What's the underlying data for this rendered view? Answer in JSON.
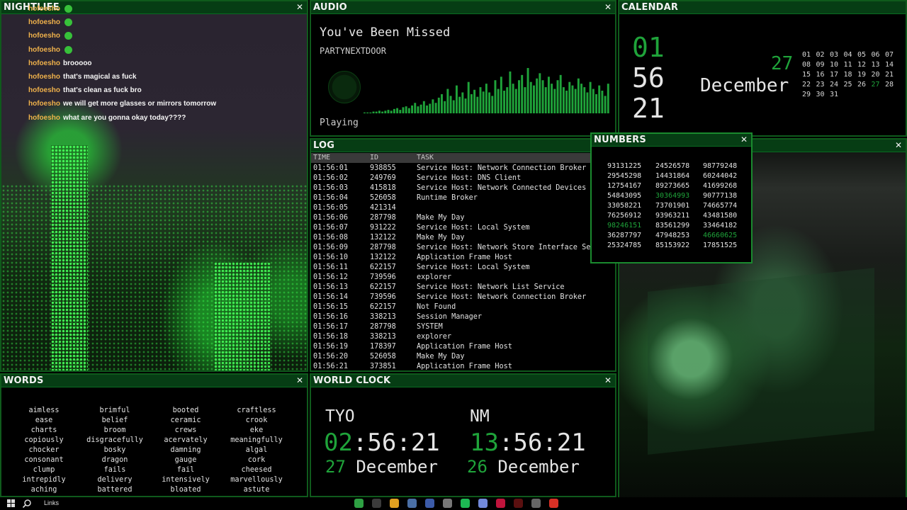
{
  "nightlife": {
    "title": "NIGHTLIFE",
    "chat": [
      {
        "user": "hofoesho",
        "msg": "",
        "emote": true
      },
      {
        "user": "hofoesho",
        "msg": "",
        "emote": true
      },
      {
        "user": "hofoesho",
        "msg": "",
        "emote": true
      },
      {
        "user": "hofoesho",
        "msg": "",
        "emote": true
      },
      {
        "user": "hofoesho",
        "msg": "brooooo",
        "emote": false
      },
      {
        "user": "hofoesho",
        "msg": "that's magical as fuck",
        "emote": false
      },
      {
        "user": "hofoesho",
        "msg": "that's clean as fuck bro",
        "emote": false
      },
      {
        "user": "hofoesho",
        "msg": "we will get more glasses or mirrors tomorrow",
        "emote": false
      },
      {
        "user": "hofoesho",
        "msg": "what are you gonna okay today????",
        "emote": false
      }
    ]
  },
  "audio": {
    "title": "AUDIO",
    "song": "You've Been Missed",
    "artist": "PARTYNEXTDOOR",
    "status": "Playing",
    "bars": [
      1,
      1,
      1,
      2,
      2,
      3,
      2,
      3,
      4,
      3,
      5,
      6,
      4,
      7,
      8,
      6,
      9,
      12,
      8,
      10,
      14,
      9,
      11,
      16,
      12,
      18,
      22,
      14,
      28,
      20,
      15,
      32,
      19,
      24,
      17,
      36,
      22,
      27,
      19,
      30,
      25,
      34,
      24,
      20,
      38,
      28,
      42,
      26,
      30,
      48,
      34,
      28,
      38,
      44,
      30,
      52,
      36,
      32,
      40,
      46,
      38,
      30,
      42,
      34,
      28,
      38,
      44,
      30,
      26,
      36,
      32,
      28,
      40,
      34,
      30,
      24,
      36,
      28,
      22,
      32,
      26,
      20,
      34
    ]
  },
  "calendar": {
    "title": "CALENDAR",
    "hour": "01",
    "minute": "56",
    "second": "21",
    "day": "27",
    "month": "December",
    "days": [
      "01",
      "02",
      "03",
      "04",
      "05",
      "06",
      "07",
      "08",
      "09",
      "10",
      "11",
      "12",
      "13",
      "14",
      "15",
      "16",
      "17",
      "18",
      "19",
      "20",
      "21",
      "22",
      "23",
      "24",
      "25",
      "26",
      "27",
      "28",
      "29",
      "30",
      "31"
    ],
    "today": "27"
  },
  "log": {
    "title": "LOG",
    "headers": {
      "time": "TIME",
      "id": "ID",
      "task": "TASK"
    },
    "rows": [
      [
        "01:56:01",
        "938855",
        "Service Host: Network Connection Broker"
      ],
      [
        "01:56:02",
        "249769",
        "Service Host: DNS Client"
      ],
      [
        "01:56:03",
        "415818",
        "Service Host: Network Connected Devices"
      ],
      [
        "01:56:04",
        "526058",
        "Runtime Broker"
      ],
      [
        "01:56:05",
        "421314",
        ""
      ],
      [
        "01:56:06",
        "287798",
        "Make My Day"
      ],
      [
        "01:56:07",
        "931222",
        "Service Host: Local System"
      ],
      [
        "01:56:08",
        "132122",
        "Make My Day"
      ],
      [
        "01:56:09",
        "287798",
        "Service Host: Network Store Interface Ser"
      ],
      [
        "01:56:10",
        "132122",
        "Application Frame Host"
      ],
      [
        "01:56:11",
        "622157",
        "Service Host: Local System"
      ],
      [
        "01:56:12",
        "739596",
        "explorer"
      ],
      [
        "01:56:13",
        "622157",
        "Service Host: Network List Service"
      ],
      [
        "01:56:14",
        "739596",
        "Service Host: Network Connection Broker"
      ],
      [
        "01:56:15",
        "622157",
        "Not Found"
      ],
      [
        "01:56:16",
        "338213",
        "Session Manager"
      ],
      [
        "01:56:17",
        "287798",
        "SYSTEM"
      ],
      [
        "01:56:18",
        "338213",
        "explorer"
      ],
      [
        "01:56:19",
        "178397",
        "Application Frame Host"
      ],
      [
        "01:56:20",
        "526058",
        "Make My Day"
      ],
      [
        "01:56:21",
        "373851",
        "Application Frame Host"
      ]
    ]
  },
  "numbers": {
    "title": "NUMBERS",
    "values": [
      [
        "93131225",
        "24526578",
        "98779248"
      ],
      [
        "29545298",
        "14431864",
        "60244042"
      ],
      [
        "12754167",
        "89273665",
        "41699268"
      ],
      [
        "54843095",
        "30364993",
        "90777138"
      ],
      [
        "33058221",
        "73701901",
        "74665774"
      ],
      [
        "76256912",
        "93963211",
        "43481580"
      ],
      [
        "98246151",
        "83561299",
        "33464182"
      ],
      [
        "36287797",
        "47948253",
        "46660625"
      ],
      [
        "25324785",
        "85153922",
        "17851525"
      ]
    ],
    "highlighted": [
      "30364993",
      "98246151",
      "46660625"
    ]
  },
  "words": {
    "title": "WORDS",
    "columns": [
      [
        "aimless",
        "ease",
        "charts",
        "copiously",
        "chocker",
        "consonant",
        "clump",
        "intrepidly",
        "aching"
      ],
      [
        "brimful",
        "belief",
        "broom",
        "disgracefully",
        "bosky",
        "dragon",
        "fails",
        "delivery",
        "battered"
      ],
      [
        "booted",
        "ceramic",
        "crews",
        "acervately",
        "damning",
        "gauge",
        "fail",
        "intensively",
        "bloated"
      ],
      [
        "craftless",
        "crook",
        "eke",
        "meaningfully",
        "algal",
        "cork",
        "cheesed",
        "marvellously",
        "astute"
      ]
    ]
  },
  "worldclock": {
    "title": "WORLD CLOCK",
    "clocks": [
      {
        "code": "TYO",
        "hour": "02",
        "rest": ":56:21",
        "day": "27",
        "month": "December"
      },
      {
        "code": "NM",
        "hour": "13",
        "rest": ":56:21",
        "day": "26",
        "month": "December"
      }
    ]
  },
  "taskbar": {
    "links_label": "Links",
    "app_colors": [
      "#2ea043",
      "#3b3b3b",
      "#e0a020",
      "#4a6fa5",
      "#3c5ba8",
      "#777777",
      "#1db954",
      "#7289da",
      "#c0143c",
      "#5a1010",
      "#666666",
      "#d93025"
    ]
  },
  "colors": {
    "accent_green": "#1fa33a",
    "panel_border": "#0f5a1c",
    "titlebar": "#063d14"
  }
}
